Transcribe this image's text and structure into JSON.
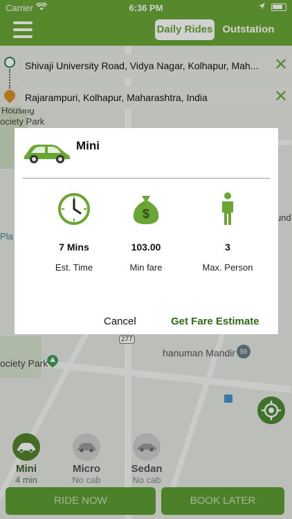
{
  "status_bar": {
    "carrier": "Carrier",
    "time": "6:36 PM"
  },
  "header": {
    "tabs": [
      {
        "label": "Daily Rides",
        "active": true
      },
      {
        "label": "Outstation",
        "active": false
      }
    ]
  },
  "route": {
    "pickup": "Shivaji University Road, Vidya Nagar, Kolhapur, Mah...",
    "drop": "Rajarampuri, Kolhapur, Maharashtra, India"
  },
  "map_labels": {
    "housing": "Housing",
    "society_park_top": "ociety Park",
    "pla": "Pla",
    "und": "und",
    "route_badge": "277",
    "hanuman": "hanuman Mandir",
    "badge_59": "59",
    "society_park_bottom": "ociety Park"
  },
  "dialog": {
    "cab_name": "Mini",
    "est_time_value": "7 Mins",
    "est_time_label": "Est. Time",
    "min_fare_value": "103.00",
    "min_fare_label": "Min fare",
    "max_person_value": "3",
    "max_person_label": "Max. Person",
    "cancel_label": "Cancel",
    "estimate_label": "Get Fare Estimate"
  },
  "cab_options": [
    {
      "name": "Mini",
      "eta": "4 min",
      "selected": true
    },
    {
      "name": "Micro",
      "eta": "No cab",
      "selected": false
    },
    {
      "name": "Sedan",
      "eta": "No cab",
      "selected": false
    }
  ],
  "actions": {
    "ride_now": "RIDE NOW",
    "book_later": "BOOK LATER"
  },
  "colors": {
    "brand_green": "#6aa636",
    "dark_green": "#2f6a17",
    "drop_pin": "#d9902a"
  }
}
